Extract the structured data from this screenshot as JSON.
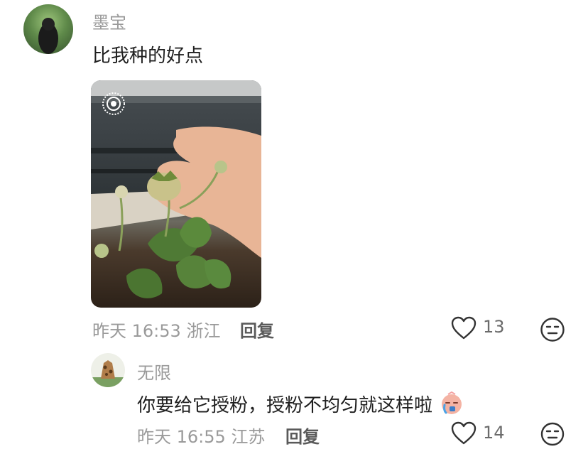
{
  "comment": {
    "author": "墨宝",
    "text": "比我种的好点",
    "date": "昨天",
    "time": "16:53",
    "location": "浙江",
    "reply_label": "回复",
    "like_count": "13"
  },
  "reply": {
    "author": "无限",
    "text": "你要给它授粉，授粉不均匀就这样啦",
    "date": "昨天",
    "time": "16:55",
    "location": "江苏",
    "reply_label": "回复",
    "like_count": "14"
  },
  "colors": {
    "muted": "#9a9a9a",
    "text": "#1f1f1f",
    "icon": "#333333"
  }
}
